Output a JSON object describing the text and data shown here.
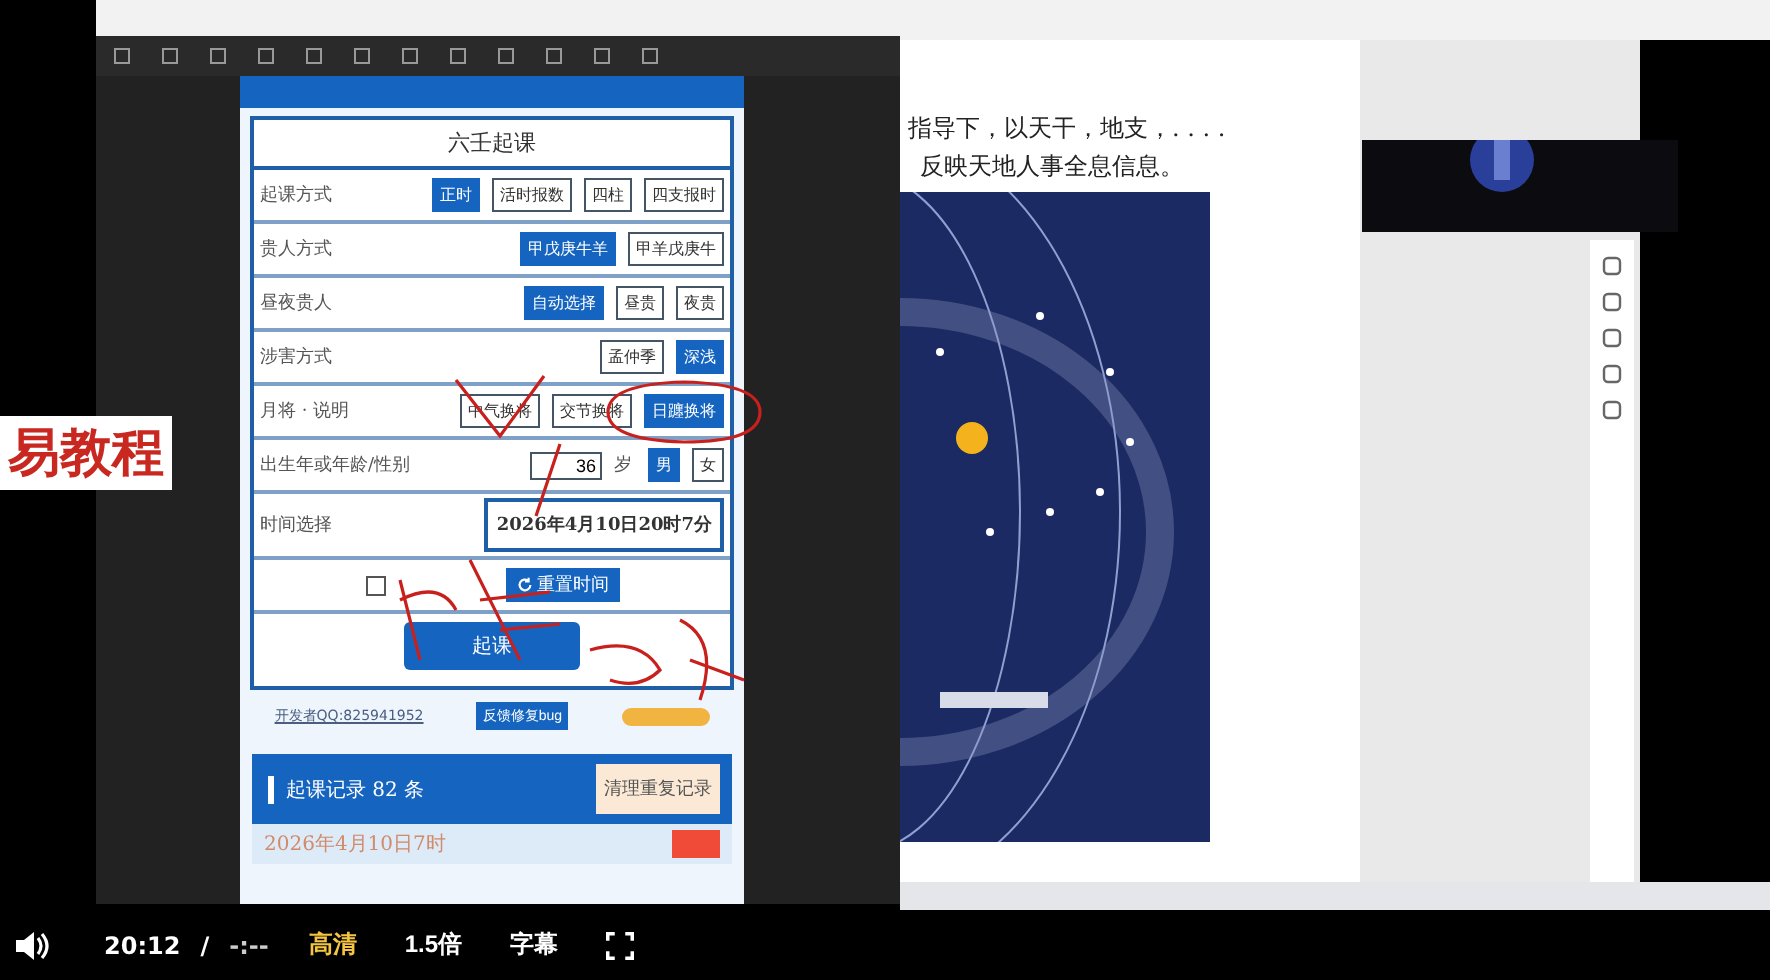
{
  "overlay_caption": "易教程",
  "app": {
    "title": "六壬起课",
    "rows": [
      {
        "kind": "options",
        "label": "起课方式",
        "options": [
          {
            "label": "正时",
            "selected": true
          },
          {
            "label": "活时报数",
            "selected": false
          },
          {
            "label": "四柱",
            "selected": false
          },
          {
            "label": "四支报时",
            "selected": false
          }
        ]
      },
      {
        "kind": "options",
        "label": "贵人方式",
        "options": [
          {
            "label": "甲戊庚牛羊",
            "selected": true
          },
          {
            "label": "甲羊戊庚牛",
            "selected": false
          }
        ]
      },
      {
        "kind": "options",
        "label": "昼夜贵人",
        "options": [
          {
            "label": "自动选择",
            "selected": true
          },
          {
            "label": "昼贵",
            "selected": false
          },
          {
            "label": "夜贵",
            "selected": false
          }
        ]
      },
      {
        "kind": "options",
        "label": "涉害方式",
        "options": [
          {
            "label": "孟仲季",
            "selected": false
          },
          {
            "label": "深浅",
            "selected": true
          }
        ]
      },
      {
        "kind": "options",
        "label": "月将 · 说明",
        "options": [
          {
            "label": "中气换将",
            "selected": false
          },
          {
            "label": "交节换将",
            "selected": false
          },
          {
            "label": "日躔换将",
            "selected": true
          }
        ]
      },
      {
        "kind": "age",
        "label": "出生年或年龄/性别",
        "value": "36",
        "unit": "岁",
        "options": [
          {
            "label": "男",
            "selected": true
          },
          {
            "label": "女",
            "selected": false
          }
        ]
      },
      {
        "kind": "time",
        "label": "时间选择",
        "value": "2026年4月10日20时7分"
      }
    ],
    "lock": {
      "checked": false
    },
    "reset_button": "重置时间",
    "submit_button": "起课",
    "developer_link": "开发者QQ:825941952",
    "feedback_button": "反馈修复bug",
    "records": {
      "title": "起课记录 82 条",
      "clear_button": "清理重复记录",
      "entries": [
        {
          "time": "2026年4月10日7时"
        }
      ]
    }
  },
  "document": {
    "lines": [
      "指导下，以天干，地支，. . . .",
      "反映天地人事全息信息。"
    ]
  },
  "player": {
    "current_time": "20:12",
    "separator": "/",
    "duration": "-:--",
    "quality": "高清",
    "speed": "1.5倍",
    "subtitles": "字幕",
    "muted": false
  }
}
